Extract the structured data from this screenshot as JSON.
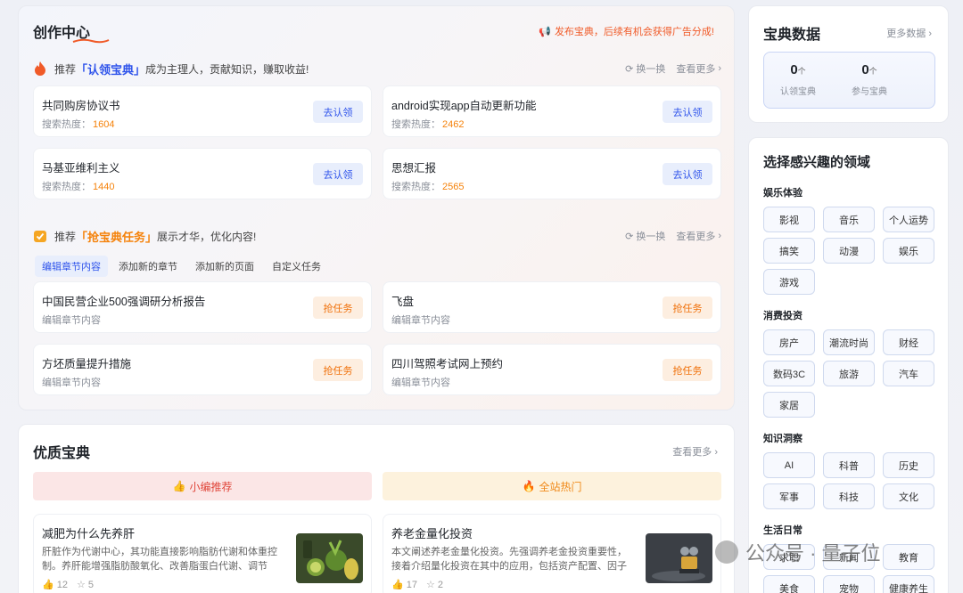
{
  "create_center": {
    "title": "创作中心",
    "promo": "发布宝典，后续有机会获得广告分成!",
    "claim_section": {
      "prefix": "推荐",
      "highlight": "「认领宝典」",
      "suffix": "成为主理人，贡献知识，赚取收益!",
      "refresh": "换一换",
      "more": "查看更多"
    },
    "claim_items": [
      {
        "title": "共同购房协议书",
        "heat_label": "搜索热度：",
        "heat": "1604",
        "button": "去认领"
      },
      {
        "title": "android实现app自动更新功能",
        "heat_label": "搜索热度：",
        "heat": "2462",
        "button": "去认领"
      },
      {
        "title": "马基亚维利主义",
        "heat_label": "搜索热度：",
        "heat": "1440",
        "button": "去认领"
      },
      {
        "title": "思想汇报",
        "heat_label": "搜索热度：",
        "heat": "2565",
        "button": "去认领"
      }
    ],
    "task_section": {
      "prefix": "推荐",
      "highlight": "「抢宝典任务」",
      "suffix": "展示才华，优化内容!",
      "refresh": "换一换",
      "more": "查看更多"
    },
    "task_tabs": [
      "编辑章节内容",
      "添加新的章节",
      "添加新的页面",
      "自定义任务"
    ],
    "task_items": [
      {
        "title": "中国民营企业500强调研分析报告",
        "sub": "编辑章节内容",
        "button": "抢任务"
      },
      {
        "title": "飞盘",
        "sub": "编辑章节内容",
        "button": "抢任务"
      },
      {
        "title": "方坯质量提升措施",
        "sub": "编辑章节内容",
        "button": "抢任务"
      },
      {
        "title": "四川驾照考试网上预约",
        "sub": "编辑章节内容",
        "button": "抢任务"
      }
    ]
  },
  "quality": {
    "title": "优质宝典",
    "more": "查看更多",
    "banner_left": "小编推荐",
    "banner_right": "全站热门",
    "articles": [
      {
        "title": "减肥为什么先养肝",
        "desc": "肝脏作为代谢中心，其功能直接影响脂肪代谢和体重控制。养肝能增强脂肪酸氧化、改善脂蛋白代谢、调节胆...",
        "likes": "12",
        "stars": "5"
      },
      {
        "title": "养老金量化投资",
        "desc": "本文阐述养老金量化投资。先强调养老金投资重要性，接着介绍量化投资在其中的应用，包括资产配置、因子投...",
        "likes": "17",
        "stars": "2"
      }
    ]
  },
  "stats": {
    "title": "宝典数据",
    "more": "更多数据",
    "items": [
      {
        "value": "0",
        "unit": "个",
        "label": "认领宝典"
      },
      {
        "value": "0",
        "unit": "个",
        "label": "参与宝典"
      }
    ]
  },
  "interests": {
    "title": "选择感兴趣的领域",
    "groups": [
      {
        "label": "娱乐体验",
        "chips": [
          "影视",
          "音乐",
          "个人运势",
          "搞笑",
          "动漫",
          "娱乐",
          "游戏"
        ]
      },
      {
        "label": "消费投资",
        "chips": [
          "房产",
          "潮流时尚",
          "财经",
          "数码3C",
          "旅游",
          "汽车",
          "家居"
        ]
      },
      {
        "label": "知识洞察",
        "chips": [
          "AI",
          "科普",
          "历史",
          "军事",
          "科技",
          "文化"
        ]
      },
      {
        "label": "生活日常",
        "chips": [
          "求职",
          "新闻",
          "教育",
          "美食",
          "宠物",
          "健康养生"
        ]
      }
    ]
  },
  "watermark": {
    "text": "公众号 · 量子位"
  },
  "colors": {
    "accent_blue": "#2f54eb",
    "accent_orange": "#f5820a"
  }
}
